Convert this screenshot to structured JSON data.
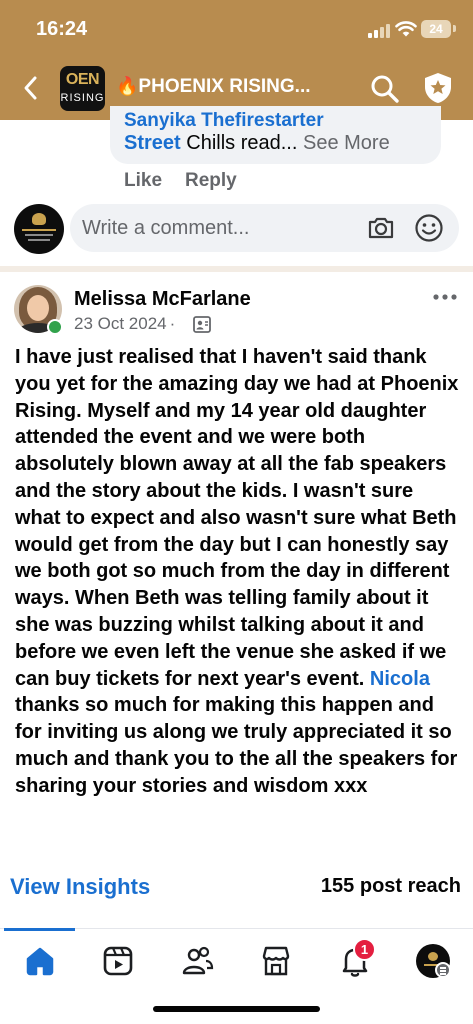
{
  "status_bar": {
    "time": "16:24",
    "battery": "24"
  },
  "nav": {
    "group_logo": {
      "line1": "OEN",
      "line2": "RISING"
    },
    "title_emoji": "🔥",
    "title": "PHOENIX RISING...",
    "icons": {
      "back": "chevron-left-icon",
      "search": "search-icon",
      "shield": "shield-star-icon"
    }
  },
  "previous_reply": {
    "name_partial": "Sanyika Thefirestarter",
    "name_tail": "Street",
    "snippet": " Chills read...",
    "see_more": " See More",
    "like": "Like",
    "reply": "Reply"
  },
  "comment_composer": {
    "placeholder": "Write a comment...",
    "icons": {
      "camera": "camera-icon",
      "emoji": "smiley-icon"
    }
  },
  "post": {
    "author": "Melissa McFarlane",
    "date": "23 Oct 2024",
    "dot": "·",
    "body_before_mention": "I have just realised that I haven't said thank you yet for the amazing day we had at Phoenix Rising. Myself and my 14 year old daughter attended the event and we were both absolutely blown away at all the fab speakers and the story about the kids. I wasn't sure what to expect and also wasn't sure what Beth would get from the day but I can honestly say we both got so much from the day in different ways. When Beth was telling family about it she was buzzing whilst talking about it and before we even left the venue she asked if we can buy tickets for next year's event.",
    "mention": "Nicola",
    "body_after_mention": " thanks so much for making this happen and for inviting us along we truly appreciated it so much and thank you to the all the speakers for sharing your stories and wisdom xxx",
    "icons": {
      "audience": "members-only-icon",
      "more": "more-dots-icon"
    }
  },
  "insights": {
    "view_label": "View Insights",
    "reach": "155 post reach"
  },
  "tabbar": {
    "tabs": [
      "home-icon",
      "video-icon",
      "friends-icon",
      "marketplace-icon",
      "bell-icon",
      "menu-avatar"
    ],
    "active": "home-icon",
    "notification_count": "1"
  }
}
